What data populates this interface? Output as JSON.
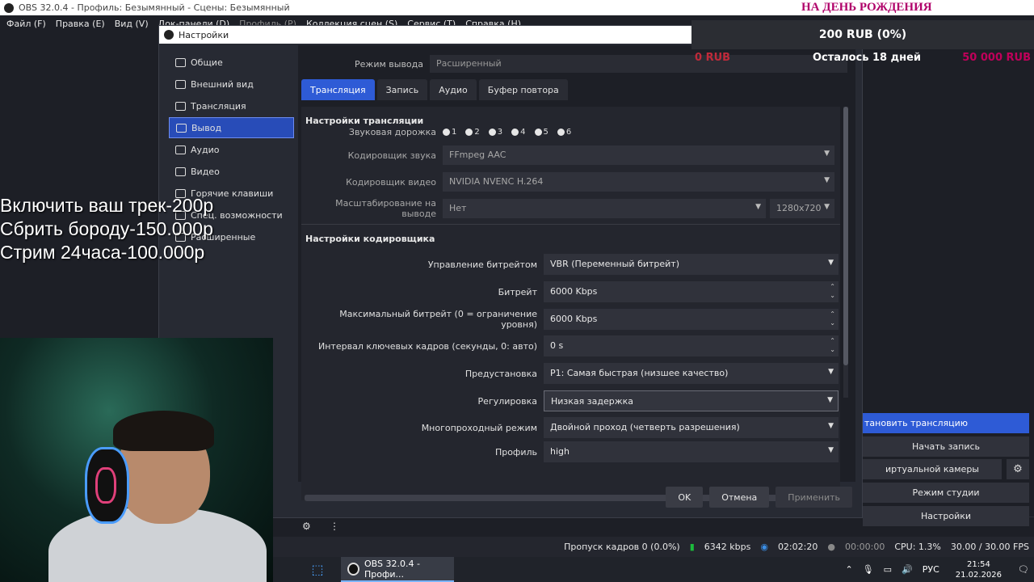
{
  "window": {
    "title": "OBS 32.0.4 - Профиль: Безымянный - Сцены: Безымянный",
    "controls": [
      "—",
      "❐",
      "✕"
    ]
  },
  "menu": {
    "items": [
      {
        "label": "Файл (F)"
      },
      {
        "label": "Правка (E)"
      },
      {
        "label": "Вид (V)"
      },
      {
        "label": "Док-панели (D)"
      },
      {
        "label": "Профиль (P)"
      },
      {
        "label": "Коллекция сцен (S)"
      },
      {
        "label": "Сервис (T)"
      },
      {
        "label": "Справка (H)"
      }
    ]
  },
  "overlay": {
    "lines": [
      "Включить ваш трек-200р",
      "Сбрить бороду-150.000р",
      "Стрим 24часа-100.000р"
    ]
  },
  "donation": {
    "title": "НА ДЕНЬ РОЖДЕНИЯ",
    "progress": "200 RUB (0%)",
    "min": "0 RUB",
    "remaining": "Осталось 18 дней",
    "goal": "50 000 RUB",
    "progress_fraction": 0.004
  },
  "settings": {
    "title": "Настройки",
    "nav": [
      {
        "label": "Общие",
        "icon": "gear-icon"
      },
      {
        "label": "Внешний вид",
        "icon": "brush-icon"
      },
      {
        "label": "Трансляция",
        "icon": "antenna-icon"
      },
      {
        "label": "Вывод",
        "icon": "output-icon"
      },
      {
        "label": "Аудио",
        "icon": "speaker-icon"
      },
      {
        "label": "Видео",
        "icon": "monitor-icon"
      },
      {
        "label": "Горячие клавиши",
        "icon": "keyboard-icon"
      },
      {
        "label": "Спец. возможности",
        "icon": "accessibility-icon"
      },
      {
        "label": "Расширенные",
        "icon": "wrench-icon"
      }
    ],
    "output_mode": {
      "label": "Режим вывода",
      "value": "Расширенный"
    },
    "tabs": [
      {
        "label": "Трансляция"
      },
      {
        "label": "Запись"
      },
      {
        "label": "Аудио"
      },
      {
        "label": "Буфер повтора"
      }
    ],
    "stream_section": "Настройки трансляции",
    "audio_track": {
      "label": "Звуковая дорожка",
      "tracks": [
        "1",
        "2",
        "3",
        "4",
        "5",
        "6"
      ]
    },
    "audio_encoder": {
      "label": "Кодировщик звука",
      "value": "FFmpeg AAC"
    },
    "video_encoder": {
      "label": "Кодировщик видео",
      "value": "NVIDIA NVENC H.264"
    },
    "rescale": {
      "label": "Масштабирование на выводе",
      "value": "Нет",
      "resolution": "1280x720"
    },
    "encoder_section": "Настройки кодировщика",
    "encoder": {
      "rate_control": {
        "label": "Управление битрейтом",
        "value": "VBR (Переменный битрейт)"
      },
      "bitrate": {
        "label": "Битрейт",
        "value": "6000 Kbps"
      },
      "max_bitrate": {
        "label": "Максимальный битрейт (0 = ограничение уровня)",
        "value": "6000 Kbps"
      },
      "keyframe": {
        "label": "Интервал ключевых кадров (секунды, 0: авто)",
        "value": "0 s"
      },
      "preset": {
        "label": "Предустановка",
        "value": "P1: Самая быстрая (низшее качество)"
      },
      "tuning": {
        "label": "Регулировка",
        "value": "Низкая задержка"
      },
      "multipass": {
        "label": "Многопроходный режим",
        "value": "Двойной проход (четверть разрешения)"
      },
      "profile": {
        "label": "Профиль",
        "value": "high"
      }
    },
    "buttons": {
      "ok": "OK",
      "cancel": "Отмена",
      "apply": "Применить"
    }
  },
  "controls": {
    "stop_stream": "тановить трансляцию",
    "start_record": "Начать запись",
    "virtual_cam": "иртуальной камеры",
    "studio_mode": "Режим студии",
    "settings": "Настройки"
  },
  "statusbar": {
    "dropped": "Пропуск кадров 0 (0.0%)",
    "bitrate": "6342 kbps",
    "stream_time": "02:02:20",
    "rec_time": "00:00:00",
    "cpu": "CPU: 1.3%",
    "fps": "30.00 / 30.00 FPS"
  },
  "taskbar": {
    "app": "OBS 32.0.4 - Профи...",
    "lang": "РУС",
    "time": "21:54",
    "date": "21.02.2026"
  }
}
